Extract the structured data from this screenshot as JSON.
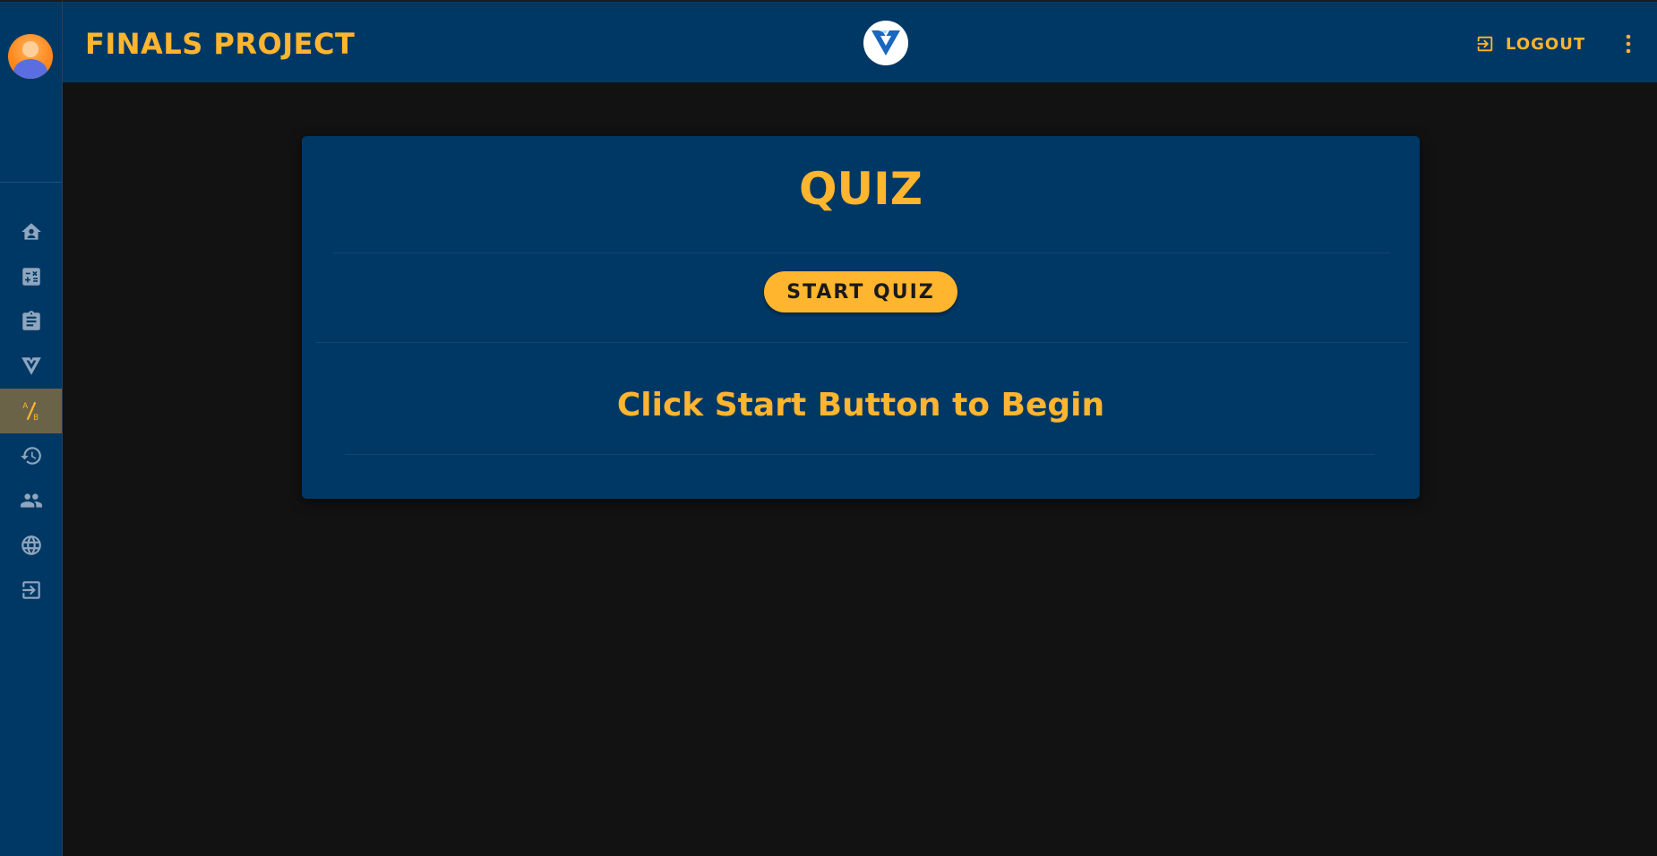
{
  "header": {
    "title": "FINALS PROJECT",
    "logout_label": "LOGOUT"
  },
  "sidebar": {
    "items": [
      {
        "icon": "home-icon"
      },
      {
        "icon": "calculator-icon"
      },
      {
        "icon": "clipboard-icon"
      },
      {
        "icon": "vuetify-icon"
      },
      {
        "icon": "ab-test-icon",
        "active": true
      },
      {
        "icon": "history-icon"
      },
      {
        "icon": "users-icon"
      },
      {
        "icon": "globe-icon"
      },
      {
        "icon": "exit-icon"
      }
    ]
  },
  "quiz": {
    "title": "QUIZ",
    "start_label": "START QUIZ",
    "message": "Click Start Button to Begin"
  },
  "colors": {
    "primary": "#003865",
    "accent": "#ffb52e",
    "background": "#121212",
    "active_nav": "#6b6348",
    "icon": "#8fa6bd"
  }
}
